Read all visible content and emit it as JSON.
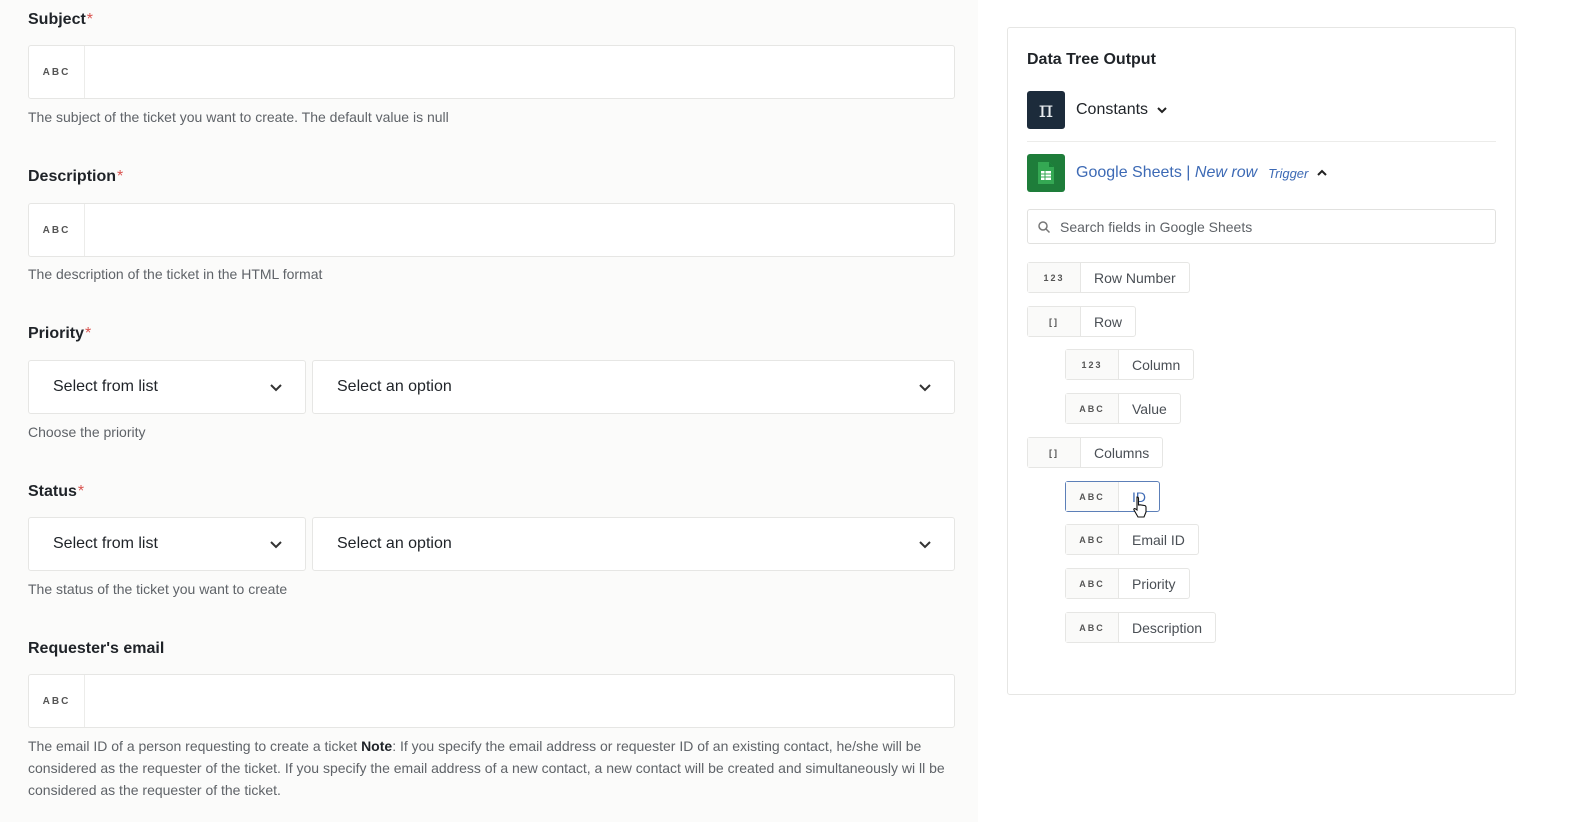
{
  "form": {
    "subject": {
      "label": "Subject",
      "required_mark": "*",
      "type_chip": "ABC",
      "value": "",
      "help": "The subject of the ticket you want to create. The default value is null"
    },
    "description": {
      "label": "Description",
      "required_mark": "*",
      "type_chip": "ABC",
      "value": "",
      "help": "The description of the ticket in the HTML format"
    },
    "priority": {
      "label": "Priority",
      "required_mark": "*",
      "mode_select": "Select from list",
      "option_select": "Select an option",
      "help": "Choose the priority"
    },
    "status": {
      "label": "Status",
      "required_mark": "*",
      "mode_select": "Select from list",
      "option_select": "Select an option",
      "help": "The status of the ticket you want to create"
    },
    "requester_email": {
      "label": "Requester's email",
      "type_chip": "ABC",
      "value": "",
      "help_pre": "The email ID of a person requesting to create a ticket ",
      "help_bold": "Note",
      "help_post": ": If you specify the email address or requester ID of an existing contact, he/she will be considered as the requester of the ticket. If you specify the email address of a new contact, a new contact will be created and simultaneously wi ll be considered as the requester of the ticket."
    }
  },
  "data_tree": {
    "title": "Data Tree Output",
    "constants": {
      "icon": "pi-icon",
      "icon_glyph": "π",
      "name": "Constants"
    },
    "google_sheets": {
      "icon": "google-sheets-icon",
      "name": "Google Sheets | ",
      "event": "New row",
      "trigger": "Trigger"
    },
    "search_placeholder": "Search fields in Google Sheets",
    "fields": [
      {
        "chip": "123",
        "label": "Row Number"
      },
      {
        "chip": "[]",
        "label": "Row"
      },
      {
        "chip": "123",
        "label": "Column"
      },
      {
        "chip": "ABC",
        "label": "Value"
      },
      {
        "chip": "[]",
        "label": "Columns"
      },
      {
        "chip": "ABC",
        "label": "ID"
      },
      {
        "chip": "ABC",
        "label": "Email ID"
      },
      {
        "chip": "ABC",
        "label": "Priority"
      },
      {
        "chip": "ABC",
        "label": "Description"
      }
    ]
  },
  "colors": {
    "accent_link": "#3d6ab5",
    "required": "#d9534f",
    "sheets_green": "#1e7d3a",
    "constants_navy": "#1c2b3b"
  }
}
